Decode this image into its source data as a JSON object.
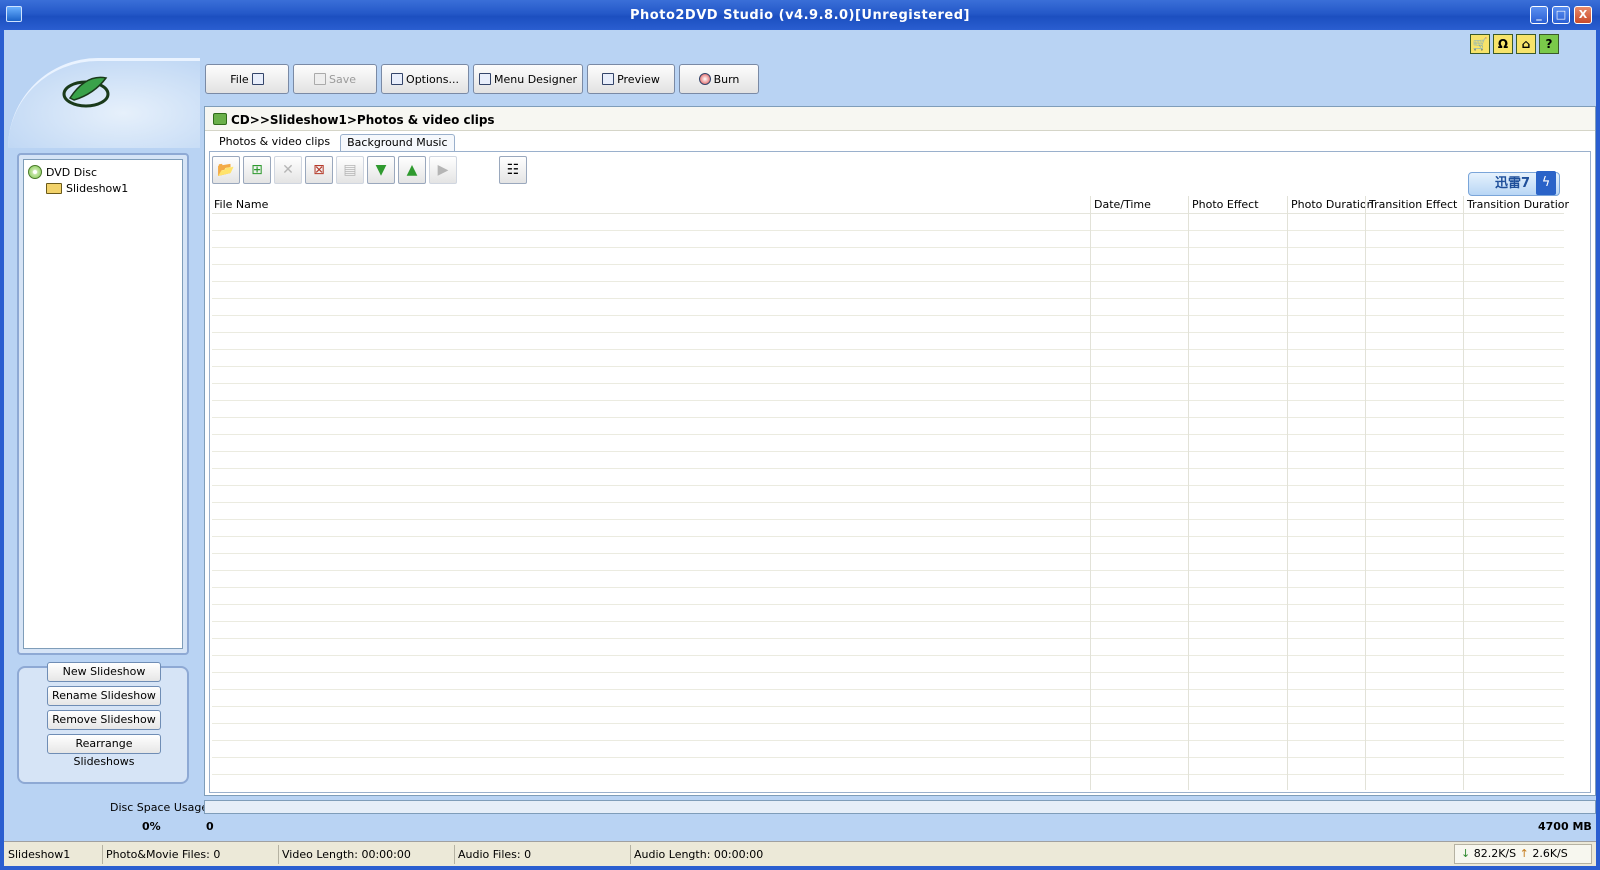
{
  "window": {
    "title": "Photo2DVD Studio (v4.9.8.0)[Unregistered]",
    "controls": [
      "_",
      "□",
      "X"
    ]
  },
  "shortcuts": [
    {
      "name": "cart-icon",
      "glyph": "🛒"
    },
    {
      "name": "support-icon",
      "glyph": "Ω"
    },
    {
      "name": "home-icon",
      "glyph": "⌂"
    },
    {
      "name": "help-icon",
      "glyph": "?"
    }
  ],
  "toolbar": {
    "file": "File",
    "save": "Save",
    "options": "Options...",
    "menu_designer": "Menu Designer",
    "preview": "Preview",
    "burn": "Burn"
  },
  "tree": {
    "root": "DVD Disc",
    "children": [
      "Slideshow1"
    ]
  },
  "side_buttons": {
    "new": "New Slideshow",
    "rename": "Rename Slideshow",
    "remove": "Remove Slideshow",
    "rearrange": "Rearrange Slideshows"
  },
  "breadcrumb": "CD>>Slideshow1>Photos & video clips",
  "tabs": {
    "photos": "Photos & video clips",
    "music": "Background Music"
  },
  "badge": {
    "text": "迅雷7",
    "tail": "ϟ"
  },
  "columns": {
    "file_name": "File Name",
    "date_time": "Date/Time",
    "photo_effect": "Photo Effect",
    "photo_duration": "Photo Duration",
    "transition_effect": "Transition Effect",
    "transition_duration": "Transition Duratior"
  },
  "disc_space": {
    "label": "Disc Space Usage:",
    "percent": "0%",
    "min": "0",
    "max": "4700 MB"
  },
  "status": {
    "slideshow": "Slideshow1",
    "photo_movie": "Photo&Movie Files: 0",
    "video_length": "Video Length: 00:00:00",
    "audio_files": "Audio Files: 0",
    "audio_length": "Audio Length: 00:00:00",
    "down_speed": "82.2K/S",
    "up_speed": "2.6K/S"
  }
}
